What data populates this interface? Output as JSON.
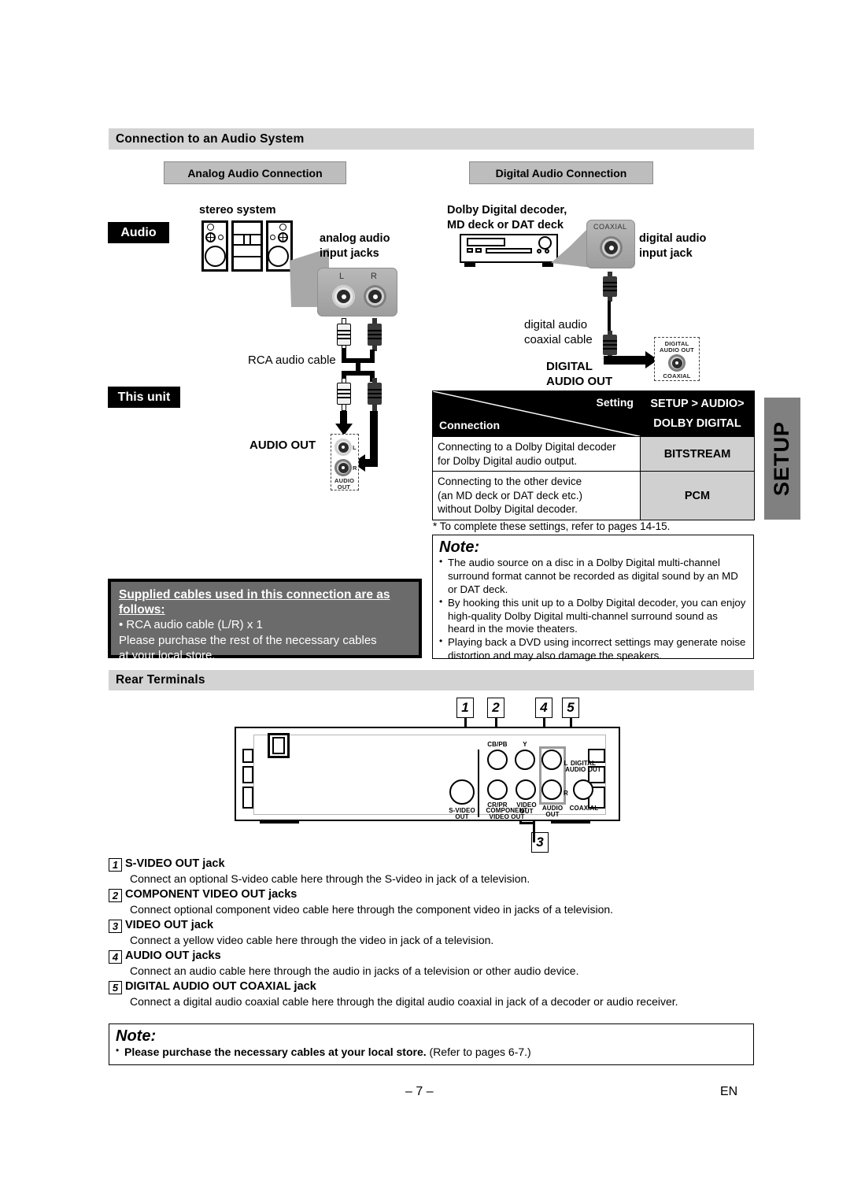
{
  "sections": {
    "audio_system": "Connection to an Audio System",
    "rear_terminals": "Rear Terminals"
  },
  "pills": {
    "analog": "Analog Audio Connection",
    "digital": "Digital Audio Connection"
  },
  "tags": {
    "audio": "Audio",
    "this_unit": "This unit"
  },
  "analog_diagram": {
    "device_label": "stereo system",
    "jacks_label_line1": "analog audio",
    "jacks_label_line2": "input jacks",
    "jack_l": "L",
    "jack_r": "R",
    "cable_label": "RCA audio cable",
    "unit_jack_label": "AUDIO OUT",
    "unit_jack_tiny_l": "L",
    "unit_jack_tiny_r": "R",
    "unit_jack_tiny_name1": "AUDIO",
    "unit_jack_tiny_name2": "OUT"
  },
  "digital_diagram": {
    "device_label_line1": "Dolby Digital decoder,",
    "device_label_line2": "MD deck or DAT deck",
    "panel_label": "COAXIAL",
    "jack_label_line1": "digital audio",
    "jack_label_line2": "input jack",
    "cable_label_line1": "digital audio",
    "cable_label_line2": "coaxial cable",
    "out_label_line1": "DIGITAL",
    "out_label_line2": "AUDIO OUT",
    "out_tiny_line1": "DIGITAL",
    "out_tiny_line2": "AUDIO OUT",
    "out_tiny_bottom": "COAXIAL"
  },
  "setting_table": {
    "header_setting": "Setting",
    "header_connection": "Connection",
    "header_right_line1": "SETUP > AUDIO>",
    "header_right_line2": "DOLBY DIGITAL",
    "rows": [
      {
        "desc_line1": "Connecting to a Dolby Digital decoder",
        "desc_line2": "for Dolby Digital audio output.",
        "desc_line3": "",
        "value": "BITSTREAM"
      },
      {
        "desc_line1": "Connecting to the other device",
        "desc_line2": "(an MD deck or DAT deck etc.)",
        "desc_line3": "without Dolby Digital decoder.",
        "value": "PCM"
      }
    ],
    "footnote": "* To complete these settings, refer to pages 14-15."
  },
  "note_top": {
    "title": "Note:",
    "items": [
      "The audio source on a disc in a Dolby Digital multi-channel surround format cannot be recorded as digital sound by an MD or DAT deck.",
      "By hooking this unit up to a Dolby Digital decoder, you can enjoy high-quality Dolby Digital multi-channel surround sound as heard in the movie theaters.",
      "Playing back a DVD using incorrect settings may generate noise distortion and may also damage the speakers."
    ]
  },
  "supplied_cables": {
    "title_line1": "Supplied cables used in this connection are as",
    "title_line2": "follows:",
    "bullet": "• RCA audio cable (L/R) x 1",
    "line2": "Please purchase the rest of the necessary cables",
    "line3": "at your local store."
  },
  "setup_tab": {
    "label": "SETUP"
  },
  "rear_panel": {
    "callouts": [
      "1",
      "2",
      "4",
      "5",
      "3"
    ],
    "labels": {
      "cb_pb": "CB/PB",
      "y": "Y",
      "cr_pr": "CR/PR",
      "s_video_out_1": "S-VIDEO",
      "s_video_out_2": "OUT",
      "component_1": "COMPONENT",
      "component_2": "VIDEO OUT",
      "video_out_1": "VIDEO",
      "video_out_2": "OUT",
      "audio_out_1": "AUDIO",
      "audio_out_2": "OUT",
      "audio_l": "L",
      "audio_r": "R",
      "digital_1": "DIGITAL",
      "digital_2": "AUDIO OUT",
      "coaxial": "COAXIAL"
    }
  },
  "jack_descriptions": [
    {
      "num": "1",
      "head": "S-VIDEO OUT jack",
      "body": "Connect an optional S-video cable here through the S-video in jack of a television."
    },
    {
      "num": "2",
      "head": "COMPONENT VIDEO OUT jacks",
      "body": "Connect optional component video cable here through the component video in jacks of a television."
    },
    {
      "num": "3",
      "head": "VIDEO OUT jack",
      "body": "Connect a yellow video cable here through the video in jack of a television."
    },
    {
      "num": "4",
      "head": "AUDIO OUT jacks",
      "body": "Connect an audio cable here through the audio in jacks of a television or other audio device."
    },
    {
      "num": "5",
      "head": "DIGITAL AUDIO OUT COAXIAL jack",
      "body": "Connect a digital audio coaxial cable here through the digital audio coaxial in jack of a decoder or audio receiver."
    }
  ],
  "note_bottom": {
    "title": "Note:",
    "bold_text": "Please purchase the necessary cables at your local store.",
    "normal_text": " (Refer to pages 6-7.)"
  },
  "footer": {
    "page": "– 7 –",
    "lang": "EN"
  }
}
